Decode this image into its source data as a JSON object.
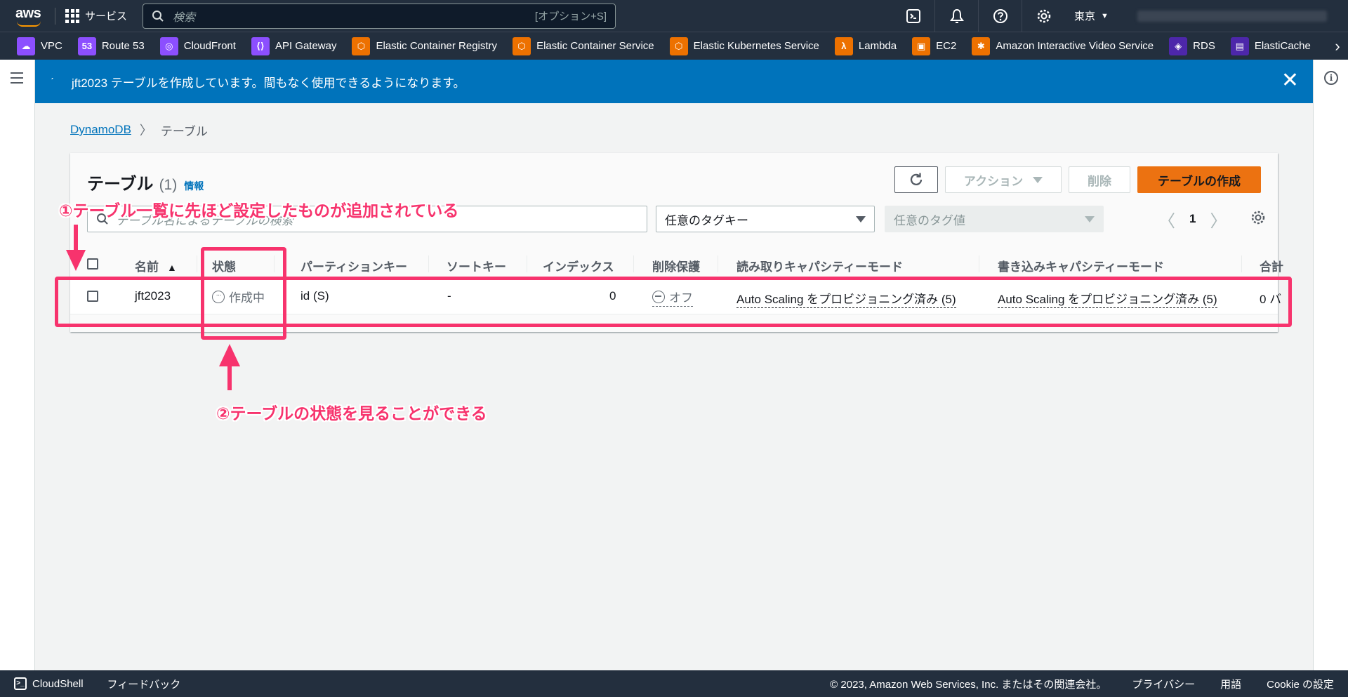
{
  "topnav": {
    "logo": "aws",
    "services_label": "サービス",
    "search_placeholder": "検索",
    "search_shortcut": "[オプション+S]",
    "region": "東京"
  },
  "favorites": [
    {
      "label": "VPC",
      "color": "#8c4fff",
      "glyph": "☁"
    },
    {
      "label": "Route 53",
      "color": "#8c4fff",
      "glyph": "53"
    },
    {
      "label": "CloudFront",
      "color": "#8c4fff",
      "glyph": "◎"
    },
    {
      "label": "API Gateway",
      "color": "#8c4fff",
      "glyph": "⟨⟩"
    },
    {
      "label": "Elastic Container Registry",
      "color": "#ed7100",
      "glyph": "⬡"
    },
    {
      "label": "Elastic Container Service",
      "color": "#ed7100",
      "glyph": "⬡"
    },
    {
      "label": "Elastic Kubernetes Service",
      "color": "#ed7100",
      "glyph": "⬡"
    },
    {
      "label": "Lambda",
      "color": "#ed7100",
      "glyph": "λ"
    },
    {
      "label": "EC2",
      "color": "#ed7100",
      "glyph": "▣"
    },
    {
      "label": "Amazon Interactive Video Service",
      "color": "#ed7100",
      "glyph": "✱"
    },
    {
      "label": "RDS",
      "color": "#4d27aa",
      "glyph": "◈"
    },
    {
      "label": "ElastiCache",
      "color": "#4d27aa",
      "glyph": "▤"
    }
  ],
  "flash": {
    "message": "jft2023 テーブルを作成しています。間もなく使用できるようになります。"
  },
  "breadcrumb": {
    "root": "DynamoDB",
    "current": "テーブル"
  },
  "table_panel": {
    "title": "テーブル",
    "count": "(1)",
    "info": "情報",
    "actions_label": "アクション",
    "delete_label": "削除",
    "create_label": "テーブルの作成",
    "filter_placeholder": "テーブル名によるテーブルの検索",
    "tag_key_placeholder": "任意のタグキー",
    "tag_value_placeholder": "任意のタグ値",
    "page": "1"
  },
  "columns": {
    "name": "名前",
    "status": "状態",
    "partition_key": "パーティションキー",
    "sort_key": "ソートキー",
    "indexes": "インデックス",
    "deletion_protection": "削除保護",
    "read_capacity": "読み取りキャパシティーモード",
    "write_capacity": "書き込みキャパシティーモード",
    "total": "合計"
  },
  "rows": [
    {
      "name": "jft2023",
      "status": "作成中",
      "partition_key": "id (S)",
      "sort_key": "-",
      "indexes": "0",
      "deletion_protection": "オフ",
      "read_capacity": "Auto Scaling をプロビジョニング済み (5)",
      "write_capacity": "Auto Scaling をプロビジョニング済み (5)",
      "total": "0 バ"
    }
  ],
  "annotations": {
    "note1": "①テーブル一覧に先ほど設定したものが追加されている",
    "note2": "②テーブルの状態を見ることができる",
    "color": "#f7336d"
  },
  "footer": {
    "cloudshell": "CloudShell",
    "feedback": "フィードバック",
    "copyright": "© 2023, Amazon Web Services, Inc. またはその関連会社。",
    "privacy": "プライバシー",
    "terms": "用語",
    "cookie": "Cookie の設定"
  }
}
